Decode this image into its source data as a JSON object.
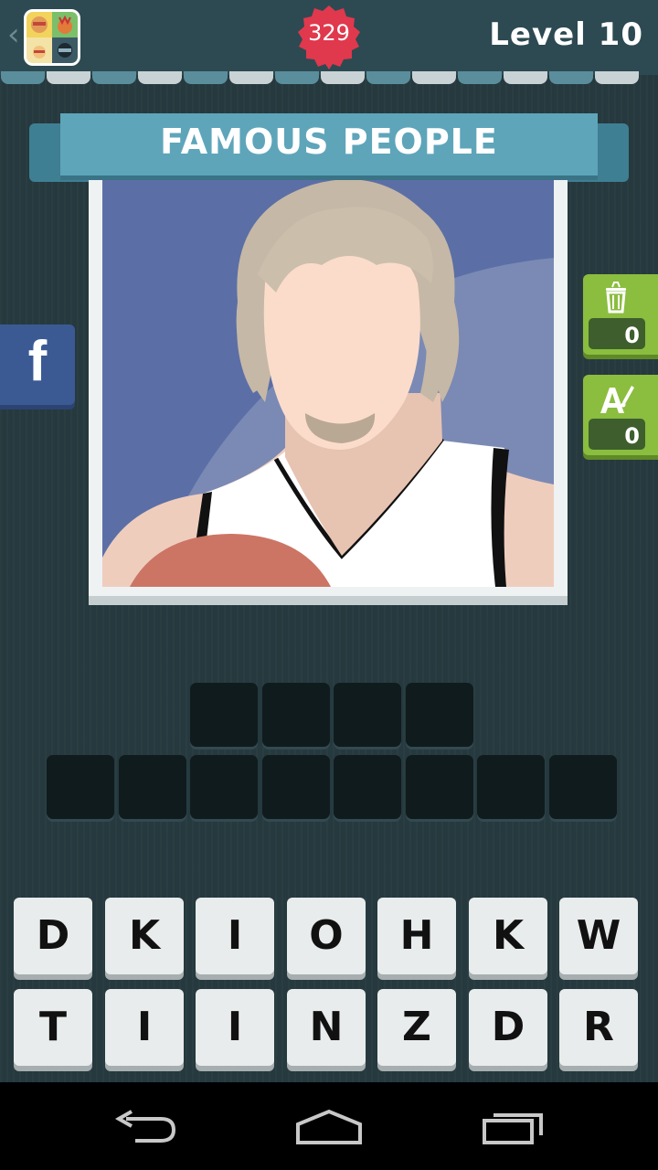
{
  "header": {
    "back_icon": "chevron-left-icon",
    "coins": "329",
    "coin_color": "#e0384d",
    "level": "Level 10"
  },
  "category": {
    "title": "FAMOUS PEOPLE"
  },
  "social": {
    "facebook_label": "f"
  },
  "hints": {
    "remove_letters_icon": "trash-icon",
    "remove_letters_count": "0",
    "reveal_letter_icon": "letter-a-brush-icon",
    "reveal_letter_count": "0"
  },
  "answer": {
    "word_lengths": [
      4,
      8
    ]
  },
  "keyboard": {
    "row1": [
      "D",
      "K",
      "I",
      "O",
      "H",
      "K",
      "W"
    ],
    "row2": [
      "T",
      "I",
      "I",
      "N",
      "Z",
      "D",
      "R"
    ]
  },
  "navbar": {
    "back_icon": "back-arrow-icon",
    "home_icon": "home-icon",
    "recents_icon": "recent-apps-icon"
  },
  "colors": {
    "accent": "#5ea5ba",
    "hint_green": "#8bbd3f",
    "facebook": "#3b5a94"
  }
}
